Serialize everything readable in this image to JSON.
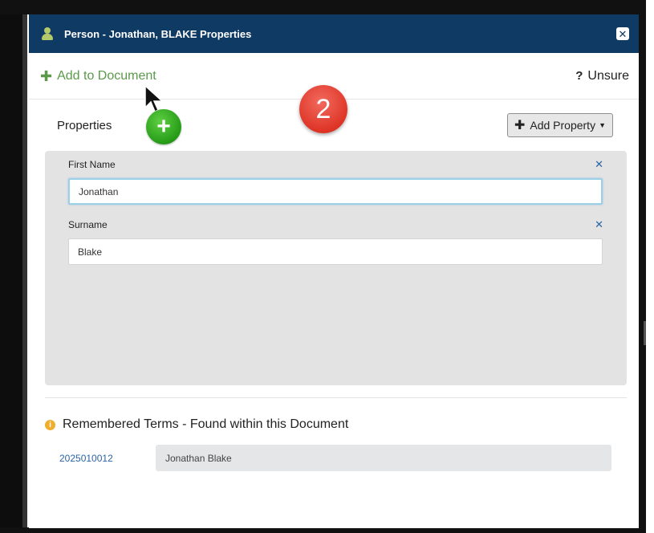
{
  "modal": {
    "title": "Person - Jonathan, BLAKE Properties",
    "close_icon": "close-icon"
  },
  "actions": {
    "add_to_document": "Add to Document",
    "unsure_mark": "?",
    "unsure": "Unsure"
  },
  "annotation": {
    "step_number": "2",
    "plus_glyph": "+"
  },
  "properties": {
    "label": "Properties",
    "add_property": "Add Property",
    "fields": [
      {
        "label": "First Name",
        "value": "Jonathan"
      },
      {
        "label": "Surname",
        "value": "Blake"
      }
    ]
  },
  "remembered": {
    "heading": "Remembered Terms - Found within this Document",
    "info_glyph": "i",
    "terms": [
      {
        "id": "2025010012",
        "value": "Jonathan Blake"
      }
    ]
  },
  "colors": {
    "header_bg": "#0f3a63",
    "accent_green": "#5a9a4a",
    "link_blue": "#2a63a7",
    "badge_red": "#de3527"
  }
}
